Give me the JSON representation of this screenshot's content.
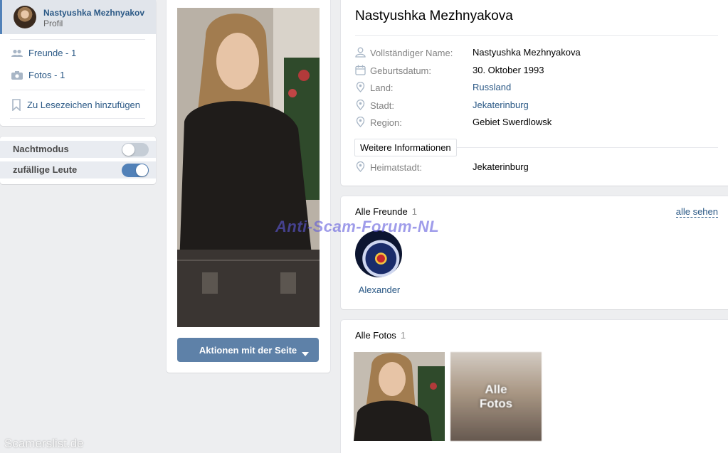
{
  "sidebar": {
    "profile_name": "Nastyushka Mezhnyakov",
    "profile_sub": "Profil",
    "friends_link": "Freunde - 1",
    "photos_link": "Fotos - 1",
    "bookmark_link": "Zu Lesezeichen hinzufügen",
    "toggles": [
      {
        "label": "Nachtmodus",
        "state": "off"
      },
      {
        "label": "zufällige Leute",
        "state": "on"
      }
    ]
  },
  "photo_column": {
    "action_button": "Aktionen mit der Seite"
  },
  "profile": {
    "name": "Nastyushka Mezhnyakova",
    "fields": [
      {
        "icon": "person-icon",
        "label": "Vollständiger Name:",
        "value": "Nastyushka Mezhnyakova",
        "link": false
      },
      {
        "icon": "calendar-icon",
        "label": "Geburtsdatum:",
        "value": "30. Oktober 1993",
        "link": false
      },
      {
        "icon": "location-pin-icon",
        "label": "Land:",
        "value": "Russland",
        "link": true
      },
      {
        "icon": "location-pin-icon",
        "label": "Stadt:",
        "value": "Jekaterinburg",
        "link": true
      },
      {
        "icon": "location-pin-icon",
        "label": "Region:",
        "value": "Gebiet Swerdlowsk",
        "link": false
      }
    ],
    "more_info_button": "Weitere Informationen",
    "hometown": {
      "icon": "location-pin-icon",
      "label": "Heimatstadt:",
      "value": "Jekaterinburg",
      "link": false
    }
  },
  "friends": {
    "title": "Alle Freunde",
    "count": "1",
    "see_all": "alle sehen",
    "items": [
      {
        "name": "Alexander"
      }
    ]
  },
  "photos": {
    "title": "Alle Fotos",
    "count": "1",
    "all_photos_label_line1": "Alle",
    "all_photos_label_line2": "Fotos"
  },
  "overlays": {
    "watermark": "Anti-Scam-Forum-NL",
    "footer_mark": "Scamerslist.de"
  },
  "colors": {
    "accent": "#5181b8",
    "link": "#2a5885",
    "background": "#edeef0"
  }
}
